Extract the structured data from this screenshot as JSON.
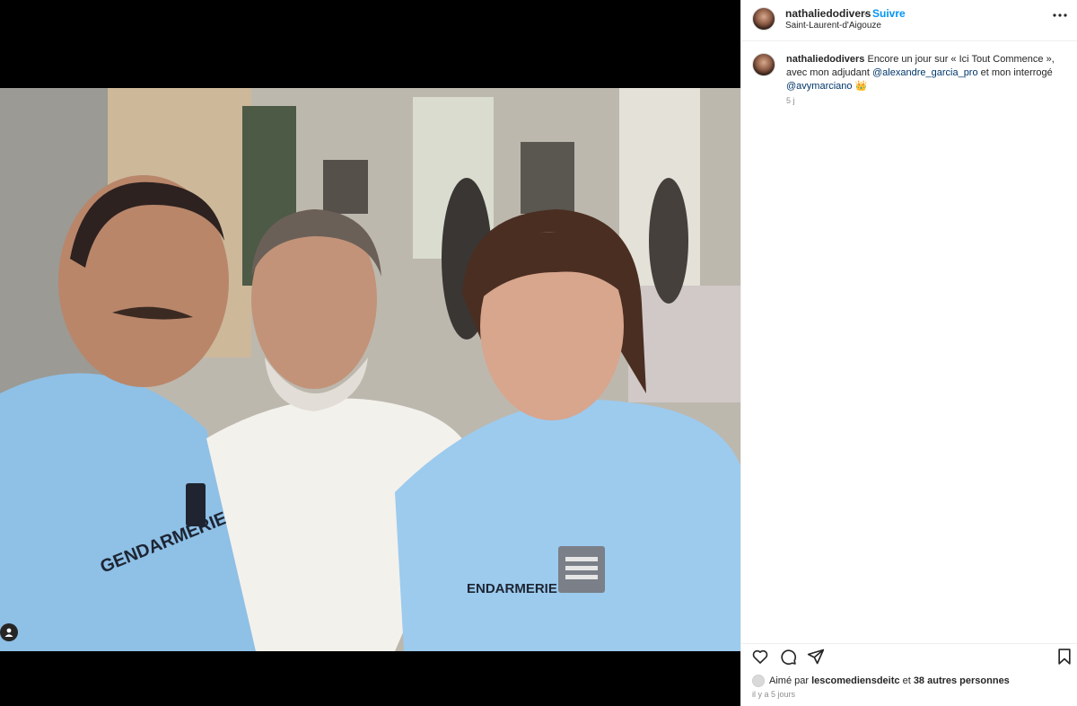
{
  "post": {
    "username": "nathaliedodivers",
    "separator": "·",
    "follow_label": "Suivre",
    "location": "Saint-Laurent-d'Aigouze"
  },
  "caption": {
    "username": "nathaliedodivers",
    "text_1": " Encore un jour sur « Ici Tout Commence », avec mon adjudant ",
    "mention_1": "@alexandre_garcia_pro",
    "text_2": " et mon interrogé ",
    "mention_2": "@avymarciano",
    "emoji": "👑",
    "age": "5 j"
  },
  "photo": {
    "shirt_text_left": "GENDARMERIE",
    "shirt_text_right": "ENDARMERIE"
  },
  "likes": {
    "prefix": "Aimé par ",
    "user": "lescomediensdeitc",
    "middle": " et ",
    "others": "38 autres personnes"
  },
  "timestamp": "il y a 5 jours",
  "icons": {
    "tag": "user-tag-icon",
    "more": "more-dots-icon",
    "like": "heart-icon",
    "comment": "comment-icon",
    "share": "share-icon",
    "save": "bookmark-icon"
  }
}
